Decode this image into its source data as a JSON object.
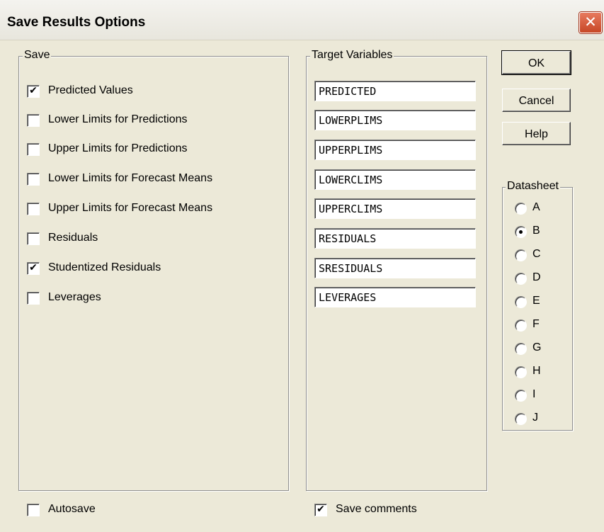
{
  "window": {
    "title": "Save Results Options",
    "close_glyph": "✕"
  },
  "save_group": {
    "legend": "Save",
    "items": [
      {
        "label": "Predicted Values",
        "checked": true
      },
      {
        "label": "Lower Limits for Predictions",
        "checked": false
      },
      {
        "label": "Upper Limits for Predictions",
        "checked": false
      },
      {
        "label": "Lower Limits for Forecast Means",
        "checked": false
      },
      {
        "label": "Upper Limits for Forecast Means",
        "checked": false
      },
      {
        "label": "Residuals",
        "checked": false
      },
      {
        "label": "Studentized Residuals",
        "checked": true
      },
      {
        "label": "Leverages",
        "checked": false
      }
    ]
  },
  "target_group": {
    "legend": "Target Variables",
    "fields": [
      "PREDICTED",
      "LOWERPLIMS",
      "UPPERPLIMS",
      "LOWERCLIMS",
      "UPPERCLIMS",
      "RESIDUALS",
      "SRESIDUALS",
      "LEVERAGES"
    ]
  },
  "buttons": {
    "ok": "OK",
    "cancel": "Cancel",
    "help": "Help"
  },
  "datasheet": {
    "legend": "Datasheet",
    "options": [
      "A",
      "B",
      "C",
      "D",
      "E",
      "F",
      "G",
      "H",
      "I",
      "J"
    ],
    "selected": "B"
  },
  "footer": {
    "autosave": {
      "label": "Autosave",
      "checked": false
    },
    "save_comments": {
      "label": "Save comments",
      "checked": true
    }
  },
  "check_glyph": "✔"
}
